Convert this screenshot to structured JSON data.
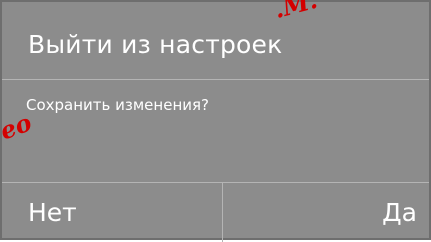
{
  "dialog": {
    "title": "Выйти из настроек",
    "message": "Сохранить изменения?",
    "buttons": {
      "no_label": "Нет",
      "yes_label": "Да"
    }
  },
  "watermark": {
    "top_text": ".M.",
    "left_text": "eo"
  },
  "colors": {
    "dialog_background": "#8c8c8c",
    "divider": "#b4b4b4",
    "text": "#ffffff",
    "watermark": "#d40000"
  }
}
